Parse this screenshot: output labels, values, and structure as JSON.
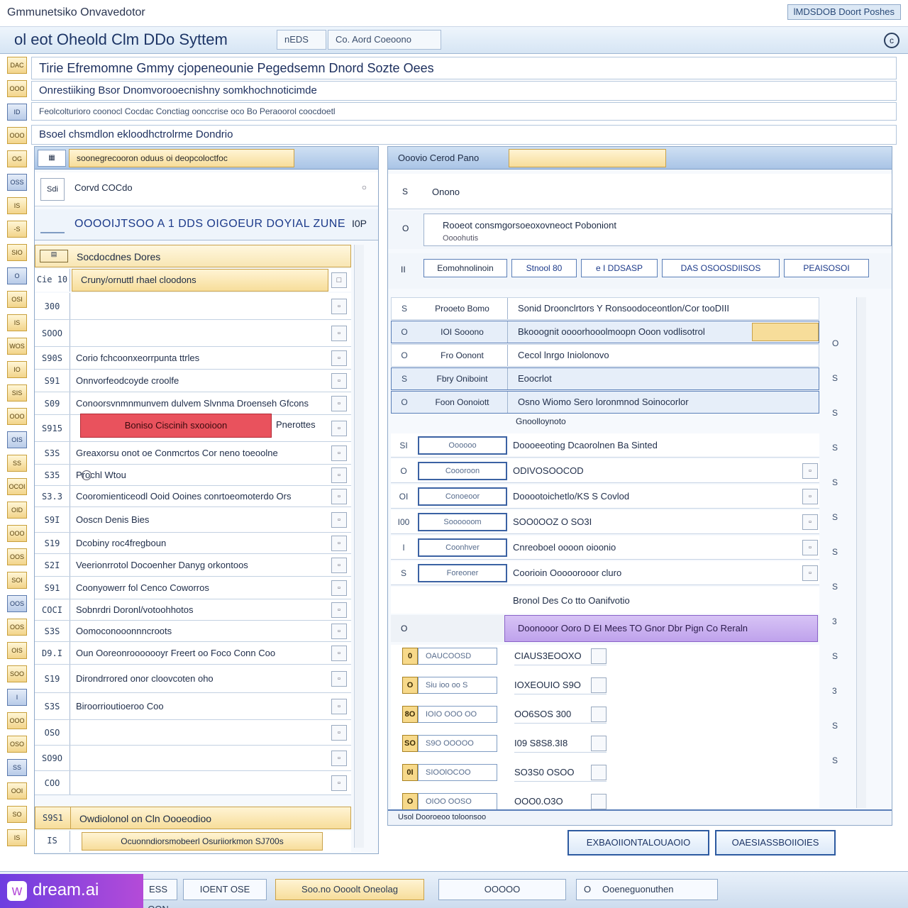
{
  "window": {
    "title": "Gmmunetsiko Onvavedotor",
    "top_button": "lMDSDOB Doort Poshes"
  },
  "appbar": {
    "title": "ol eot Oheold Clm DDo Syttem",
    "tab1": "nEDS",
    "tab2": "Co. Aord Coeoono",
    "help": "c"
  },
  "header": {
    "line1": "Tirie Efremomne Gmmy cjopeneounie Pegedsemn Dnord Sozte Oees",
    "line2": "Onrestiiking Bsor Dnomvorooecnishny somkhochnoticimde",
    "line3": "Feolcolturioro coonocl Cocdac Conctiag oonccrise oco Bo Peraoorol coocdoetl",
    "line4": "Bsoel chsmdlon ekloodhctrolrme Dondrio"
  },
  "left_panel": {
    "header": "soonegrecooron oduus oi deopcoloctfoc",
    "row0_label": "Corvd COCdo",
    "row0_icon": "Sdi",
    "summary": "OOOOIJTSOO A 1 DDS OIGOEUR DOYIAL ZUNE",
    "summary_right": "I0P",
    "list_header": "Socdocdnes Dores",
    "list_sub": "Cruny/ornuttl rhael cloodons",
    "rows": [
      {
        "num": "Cie 10",
        "text": ""
      },
      {
        "num": "300",
        "text": ""
      },
      {
        "num": "SOOO",
        "text": ""
      },
      {
        "num": "S90S",
        "text": "Corio fchcoonxeorrpunta ttrles"
      },
      {
        "num": "S91",
        "text": "Onnvorfeodcoyde croolfe"
      },
      {
        "num": "S09",
        "text": "Conoorsvnmnmunvem dulvem Slvnma Droenseh Gfcons"
      },
      {
        "num": "S915",
        "text": ""
      },
      {
        "num": "S3S",
        "text": "Greaxorsu onot oe Conmcrtos Cor neno toeoolne"
      },
      {
        "num": "S35",
        "text": "Prochl Wtou"
      },
      {
        "num": "S3.3",
        "text": "Cooromienticeodl Ooid Ooines conrtoeomoterdo Ors"
      },
      {
        "num": "S9I",
        "text": "Ooscn Denis Bies"
      },
      {
        "num": "S19",
        "text": "Dcobiny roc4fregboun"
      },
      {
        "num": "S2I",
        "text": "Veerionrrotol Docoenher Danyg orkontoos"
      },
      {
        "num": "S91",
        "text": "Coonyowerr fol Cenco Coworros"
      },
      {
        "num": "COCI",
        "text": "Sobnrdri Doronl/votoohhotos"
      },
      {
        "num": "S3S",
        "text": "Oomoconooonnncroots"
      },
      {
        "num": "D9.I",
        "text": "Oun Ooreonrooooooyr Freert oo Foco Conn Coo"
      },
      {
        "num": "S19",
        "text": "Dirondrrored onor cloovcoten oho"
      },
      {
        "num": "S3S",
        "text": "Biroorrioutioeroo Coo"
      },
      {
        "num": "OSO",
        "text": ""
      },
      {
        "num": "SO9O",
        "text": ""
      },
      {
        "num": "COO",
        "text": ""
      }
    ],
    "red_button": "Boniso Ciscinih sxooioon",
    "red_side": "Pnerottes",
    "bottom_row": "Owdiolonol on Cln Oooeodioo",
    "bottom_num": "S9S1",
    "footer": "Ocuonndiorsmobeerl Osuriiorkmon SJ700s",
    "footer_num": "IS"
  },
  "right_panel": {
    "header": "Ooovio Cerod Pano",
    "row0": "Onono",
    "row0_num": "S",
    "info_title": "Rooeot consmgorsoeoxovneoct Poboniont",
    "info_sub": "Oooohutis",
    "info_num": "O",
    "toolbar_num": "II",
    "toolbar_items": [
      "Eomohnolinoin",
      "Stnool 80",
      "e I DDSASP",
      "DAS OSOOSDIISOS",
      "PEAISOSOI"
    ],
    "detail_rows": [
      {
        "n": "S",
        "label": "Prooeto Bomo",
        "value": "Sonid Droonclrtors Y Ronsoodoceontlon/Cor tooDIII"
      },
      {
        "n": "O",
        "label": "IOI Sooono",
        "value": "Bkooognit oooorhooolmoopn Ooon vodlisotrol"
      },
      {
        "n": "O",
        "label": "Fro Oonont",
        "value": "Cecol lnrgo Iniolonovo"
      },
      {
        "n": "S",
        "label": "Fbry Oniboint",
        "value": "Eoocrlot"
      },
      {
        "n": "O",
        "label": "Foon Oonoiott",
        "value": "Osno Wiomo Sero loronmnod Soinocorlor"
      }
    ],
    "group_label": "Gnoolloynoto",
    "field_rows": [
      {
        "n": "SI",
        "field": "Oooooo",
        "value": "Doooeeoting Dcaorolnen Ba Sinted"
      },
      {
        "n": "O",
        "field": "Coooroon",
        "value": "ODIVOSOOCOD"
      },
      {
        "n": "OI",
        "field": "Conoeoor",
        "value": "Dooootoichetlo/KS S Covlod"
      },
      {
        "n": "I00",
        "field": "Soooooom",
        "value": "SOO0OOZ O SO3I"
      },
      {
        "n": "I",
        "field": "Coonhver",
        "value": "Cnreoboel oooon oioonio"
      },
      {
        "n": "S",
        "field": "Foreoner",
        "value": "Coorioin Ooooorooor cluro"
      }
    ],
    "comment": "Bronol Des Co tto Oanifvotio",
    "purple_bar": "Doonooor Ooro D EI Mees TO Gnor Dbr Pign Co Reraln",
    "purple_num": "O",
    "small_rows": [
      {
        "badge": "0",
        "field": "OAUCOOSD",
        "value": "CIAUS3EOOXO"
      },
      {
        "badge": "O",
        "field": "Siu ioo oo S",
        "value": "IOXEOUIO S9O"
      },
      {
        "badge": "8O",
        "field": "IOIO OOO OO",
        "value": "OO6SOS 300"
      },
      {
        "badge": "SO",
        "field": "S9O OOOOO",
        "value": "I09 S8S8.3I8"
      },
      {
        "badge": "0I",
        "field": "SIOOlOCOO",
        "value": "SO3S0 OSOO"
      },
      {
        "badge": "O",
        "field": "OIOO OOSO",
        "value": "OOO0.O3O"
      }
    ],
    "side_nums": [
      "O",
      "S",
      "S",
      "S",
      "S",
      "S",
      "S",
      "S",
      "3",
      "S",
      "3",
      "S",
      "S"
    ],
    "footer": "Usol Dooroeoo toloonsoo",
    "btn1": "EXBAOIIONTALOUAOIO",
    "btn2": "OAESIASSBOIIOIES"
  },
  "statusbar": {
    "s1": "ESS OON",
    "s2": "IOENT OSE",
    "s3": "Soo.no Oooolt Oneolag",
    "s4": "OOOOO",
    "s5": "Ooeneguonuthen",
    "s5_icon": "O"
  },
  "iconcol": [
    "DAC",
    "OOO",
    "ID",
    "OOO",
    "OG",
    "OSS",
    "IS",
    "-S",
    "SIO",
    "O",
    "OSI",
    "IS",
    "WOS",
    "IO",
    "SIS",
    "OOO",
    "OIS",
    "SS",
    "OCOI",
    "OID",
    "OOO",
    "OOS",
    "SOI",
    "OOS",
    "OOS",
    "OIS",
    "SOO",
    "I",
    "OOO",
    "OSO",
    "SS",
    "OOI",
    "SO",
    "IS"
  ],
  "logo": "dream.ai"
}
